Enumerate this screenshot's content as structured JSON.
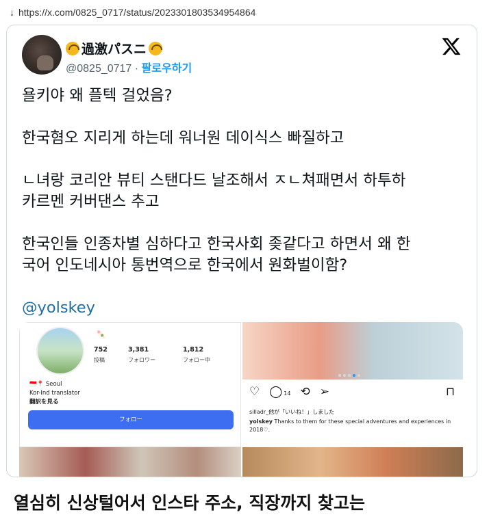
{
  "url_bar": {
    "arrow": "↓",
    "url": "https://x.com/0825_0717/status/2023301803534954864"
  },
  "tweet": {
    "display_name": "過激パスニ",
    "handle": "@0825_0717",
    "separator": "·",
    "follow_label": "팔로우하기",
    "text_lines": [
      "욜키야 왜 플텍 걸었음?",
      "",
      "한국혐오 지리게 하는데 워너원 데이식스 빠질하고",
      "",
      "ㄴ녀랑 코리안 뷰티 스탠다드 날조해서 ㅈㄴ쳐패면서 하투하",
      "카르멘 커버댄스 추고",
      "",
      "한국인들 인종차별 심하다고 한국사회 좆같다고 하면서 왜 한",
      "국어 인도네시아 통번역으로 한국에서 원화벌이함?",
      ""
    ],
    "mention": "@yolskey",
    "emoji_icon": "upside-down-face-icon"
  },
  "media": {
    "profile": {
      "small_icon": "🍡",
      "stats": [
        {
          "num": "752",
          "label": "投稿"
        },
        {
          "num": "3,381",
          "label": "フォロワー"
        },
        {
          "num": "1,812",
          "label": "フォロー中"
        }
      ],
      "location": "🇮🇩📍 Seoul",
      "bio": "Kor-Ind translator",
      "translate": "翻訳を見る",
      "follow_button": "フォロー"
    },
    "post": {
      "comment_count": "14",
      "likes_line": "silladr_他が「いいね！」しました",
      "caption_user": "yolskey",
      "caption_text": "Thanks to them for these special adventures and experiences in 2018♡."
    }
  },
  "caption_bottom": "열심히 신상털어서 인스타 주소, 직장까지 찾고는"
}
